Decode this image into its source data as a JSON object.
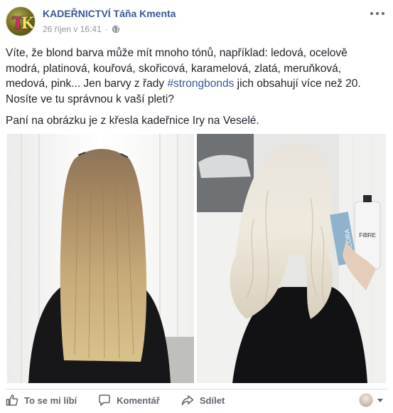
{
  "post": {
    "page_name": "KADEŘNICTVÍ Táňa Kmenta",
    "timestamp": "26 říjen v 16:41",
    "separator": "·",
    "avatar_initials": "TK",
    "paragraph1_a": "Víte, že blond barva může mít mnoho tónů, například: ledová, ocelově modrá, platinová, kouřová, skořicová, karamelová, zlatá, meruňková, medová, pink... Jen barvy z řady ",
    "hashtag": "#strongbonds",
    "paragraph1_b": " jich obsahují více než 20. Nosíte ve tu správnou k vaší pleti?",
    "paragraph2": "Paní na obrázku je z křesla kadeřnice Iry na Veselé."
  },
  "photos": {
    "left_alt": "",
    "right_box_text": "ICORA",
    "right_bottle_text": "FIBRE"
  },
  "actions": {
    "like": "To se mi líbí",
    "comment": "Komentář",
    "share": "Sdílet"
  },
  "colors": {
    "link": "#385898",
    "meta": "#90949c",
    "action": "#606770"
  }
}
